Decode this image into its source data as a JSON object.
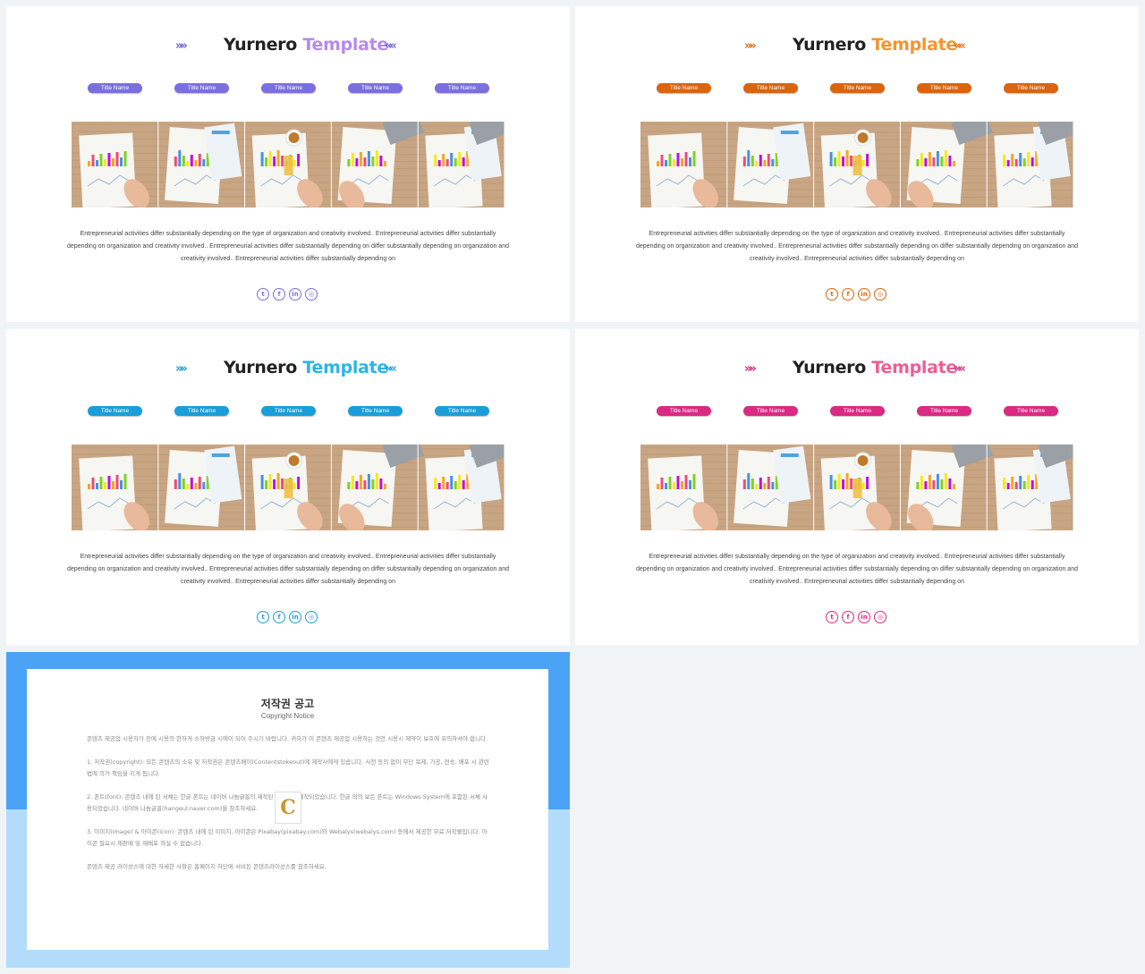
{
  "slides": [
    {
      "variant": "purple",
      "title_main": "Yurnero",
      "title_accent": "Template",
      "accent_color": "#b68be8",
      "chevron_color": "#6a62d6",
      "pill_color": "#7b6fe0",
      "pill_labels": [
        "Title Name",
        "Title Name",
        "Title Name",
        "Title Name",
        "Title Name"
      ],
      "description": "Entrepreneurial activities differ substantially depending on the type of organization and creativity involved.. Entrepreneurial activities differ substantially depending on organization and creativity involved.. Entrepreneurial activities differ substantially depending on differ substantially depending on organization and creativity involved.. Entrepreneurial activities differ substantially depending on",
      "social_icons": [
        "twitter-icon",
        "facebook-icon",
        "linkedin-icon",
        "instagram-icon"
      ]
    },
    {
      "variant": "orange",
      "title_main": "Yurnero",
      "title_accent": "Template",
      "accent_color": "#f2962e",
      "chevron_color": "#d7721c",
      "pill_color": "#d9650f",
      "pill_labels": [
        "Title Name",
        "Title Name",
        "Title Name",
        "Title Name",
        "Title Name"
      ],
      "description": "Entrepreneurial activities differ substantially depending on the type of organization and creativity involved.. Entrepreneurial activities differ substantially depending on organization and creativity involved.. Entrepreneurial activities differ substantially depending on differ substantially depending on organization and creativity involved.. Entrepreneurial activities differ substantially depending on",
      "social_icons": [
        "twitter-icon",
        "facebook-icon",
        "linkedin-icon",
        "instagram-icon"
      ]
    },
    {
      "variant": "blue",
      "title_main": "Yurnero",
      "title_accent": "Template",
      "accent_color": "#2ab6e6",
      "chevron_color": "#1e9bd6",
      "pill_color": "#1a9ed9",
      "pill_labels": [
        "Title Name",
        "Title Name",
        "Title Name",
        "Title Name",
        "Title Name"
      ],
      "description": "Entrepreneurial activities differ substantially depending on the type of organization and creativity involved.. Entrepreneurial activities differ substantially depending on organization and creativity involved.. Entrepreneurial activities differ substantially depending on differ substantially depending on organization and creativity involved.. Entrepreneurial activities differ substantially depending on",
      "social_icons": [
        "twitter-icon",
        "facebook-icon",
        "linkedin-icon",
        "instagram-icon"
      ]
    },
    {
      "variant": "pink",
      "title_main": "Yurnero",
      "title_accent": "Template",
      "accent_color": "#ec5e96",
      "chevron_color": "#d5257d",
      "pill_color": "#da2a84",
      "pill_labels": [
        "Title Name",
        "Title Name",
        "Title Name",
        "Title Name",
        "Title Name"
      ],
      "description": "Entrepreneurial activities differ substantially depending on the type of organization and creativity involved.. Entrepreneurial activities differ substantially depending on organization and creativity involved.. Entrepreneurial activities differ substantially depending on differ substantially depending on organization and creativity involved.. Entrepreneurial activities differ substantially depending on",
      "social_icons": [
        "twitter-icon",
        "facebook-icon",
        "linkedin-icon",
        "instagram-icon"
      ]
    }
  ],
  "chevrons": {
    "left": "»»",
    "right": "««"
  },
  "social_glyphs": [
    "t",
    "f",
    "in",
    "◎"
  ],
  "copyright": {
    "title": "저작권 공고",
    "subtitle": "Copyright Notice",
    "paragraphs": [
      "콘텐츠 제공업 시용자가 전에 시용의 한하게 소하방금 시에이 되어 주시기 바랍니다. 귀하가 이 콘텐츠 제공업 시용하는 것만 시용시 제약이 보호에 유의하셔야 합니다.",
      "1. 저작권(copyright): 모든 콘텐츠의 소유 및 저작권은 콘텐츠배이(Contentstokeout)에 제작사에게 있습니다. 사전 동의 없이 무단 복제, 가공, 전송, 배포 시 관련 법에 의거 책임을 지게 됩니다.",
      "2. 폰트(font): 콘텐츠 내에 된 서체는 한글 폰트는 네이버 나눔글꼴의 제작된 서체이며 제작되었습니다. 한글 외의 보든 폰트는 Windows System에 포함된 서체 사용되었습니다. 네이버 나눔글꼴(hangeul.naver.com)을 참조하세요.",
      "3. 이미지(image) & 아이콘(icon): 콘텐츠 내에 된 이미지, 아이콘은 Pixabay(pixabay.com)와 Webalys(webalys.com) 등에서 제공한 무료 저작물입니다. 아이콘 필요시 재판매 및 재배포 하실 수 없습니다.",
      "콘텐츠 제공 라이선스에 대한 자세한 사항은 홈페이지 하단에 서비된 콘텐츠라이선스를 참조하세요."
    ],
    "logo_letter": "C"
  }
}
